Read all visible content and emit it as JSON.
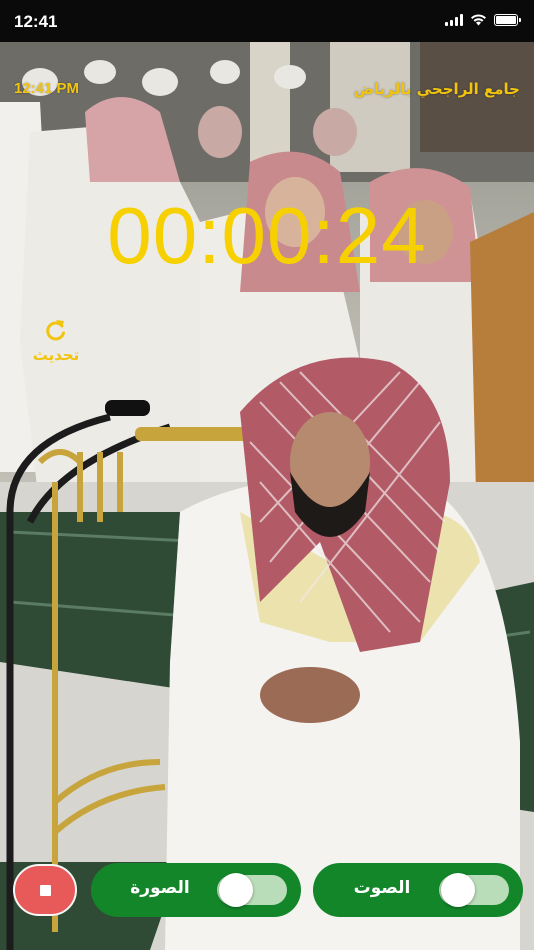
{
  "status_bar": {
    "time": "12:41",
    "icons": [
      "signal-icon",
      "wifi-icon",
      "battery-icon"
    ]
  },
  "overlay": {
    "clock": "12:41 PM",
    "mosque_name": "جامع الراجحي بالرياض",
    "timer": "00:00:24",
    "refresh_label": "تحديث",
    "refresh_icon": "refresh-icon"
  },
  "controls": {
    "stop_icon": "stop-icon",
    "image_toggle_label": "الصورة",
    "image_toggle_on": false,
    "sound_toggle_label": "الصوت",
    "sound_toggle_on": false
  },
  "colors": {
    "overlay_text": "#f1c40f",
    "timer": "#f6d000",
    "pill_green": "#13862a",
    "stop_red": "#e85a5a"
  }
}
